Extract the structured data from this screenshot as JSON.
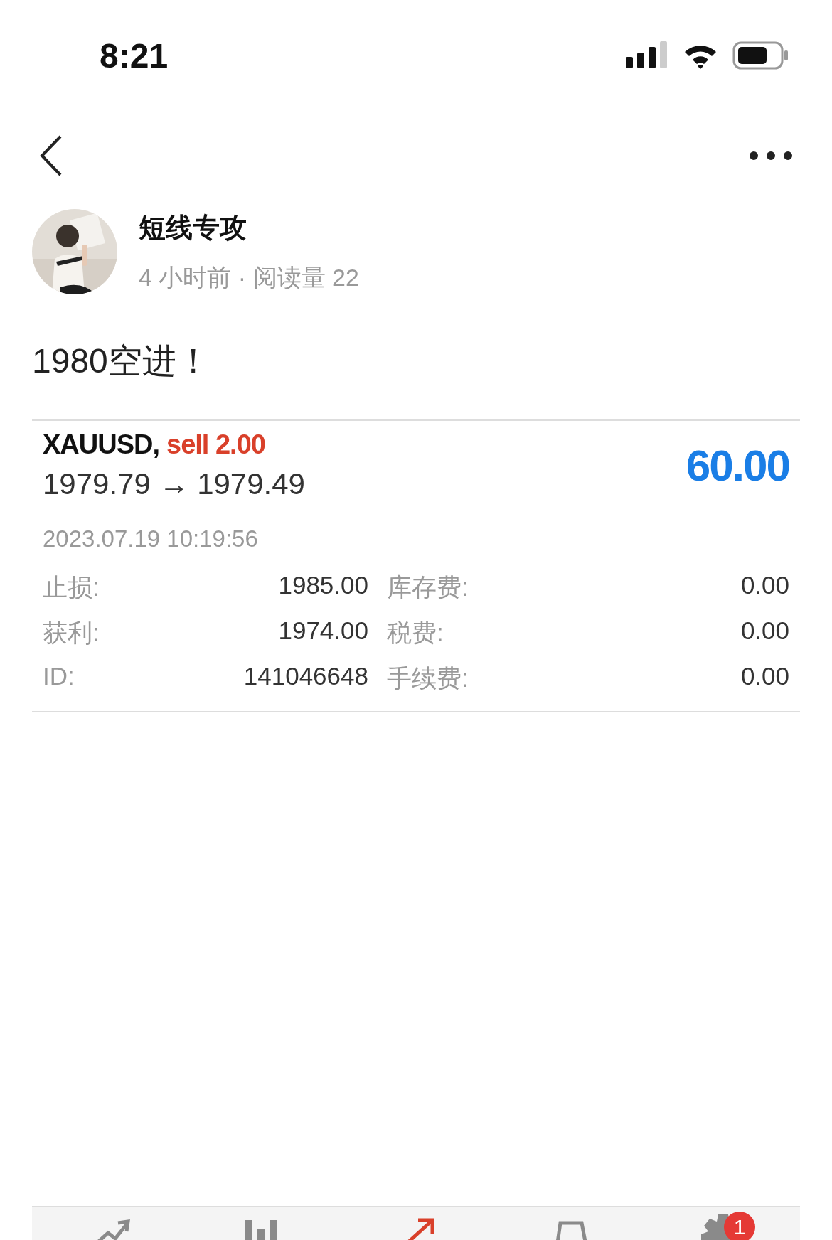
{
  "status_bar": {
    "time": "8:21"
  },
  "post": {
    "author": "短线专攻",
    "meta": "4 小时前 · 阅读量 22",
    "text": "1980空进！"
  },
  "trade": {
    "symbol": "XAUUSD,",
    "side": "sell 2.00",
    "prices": "1979.79 → 1979.49",
    "profit": "60.00",
    "time": "2023.07.19 10:19:56",
    "rows": [
      {
        "label": "止损:",
        "value": "1985.00",
        "label2": "库存费:",
        "value2": "0.00"
      },
      {
        "label": "获利:",
        "value": "1974.00",
        "label2": "税费:",
        "value2": "0.00"
      },
      {
        "label": "ID:",
        "value": "141046648",
        "label2": "手续费:",
        "value2": "0.00"
      }
    ]
  },
  "tabs": [
    {
      "selected": false
    },
    {
      "selected": false
    },
    {
      "selected": true
    },
    {
      "selected": false
    },
    {
      "selected": false,
      "badge": "1"
    }
  ]
}
